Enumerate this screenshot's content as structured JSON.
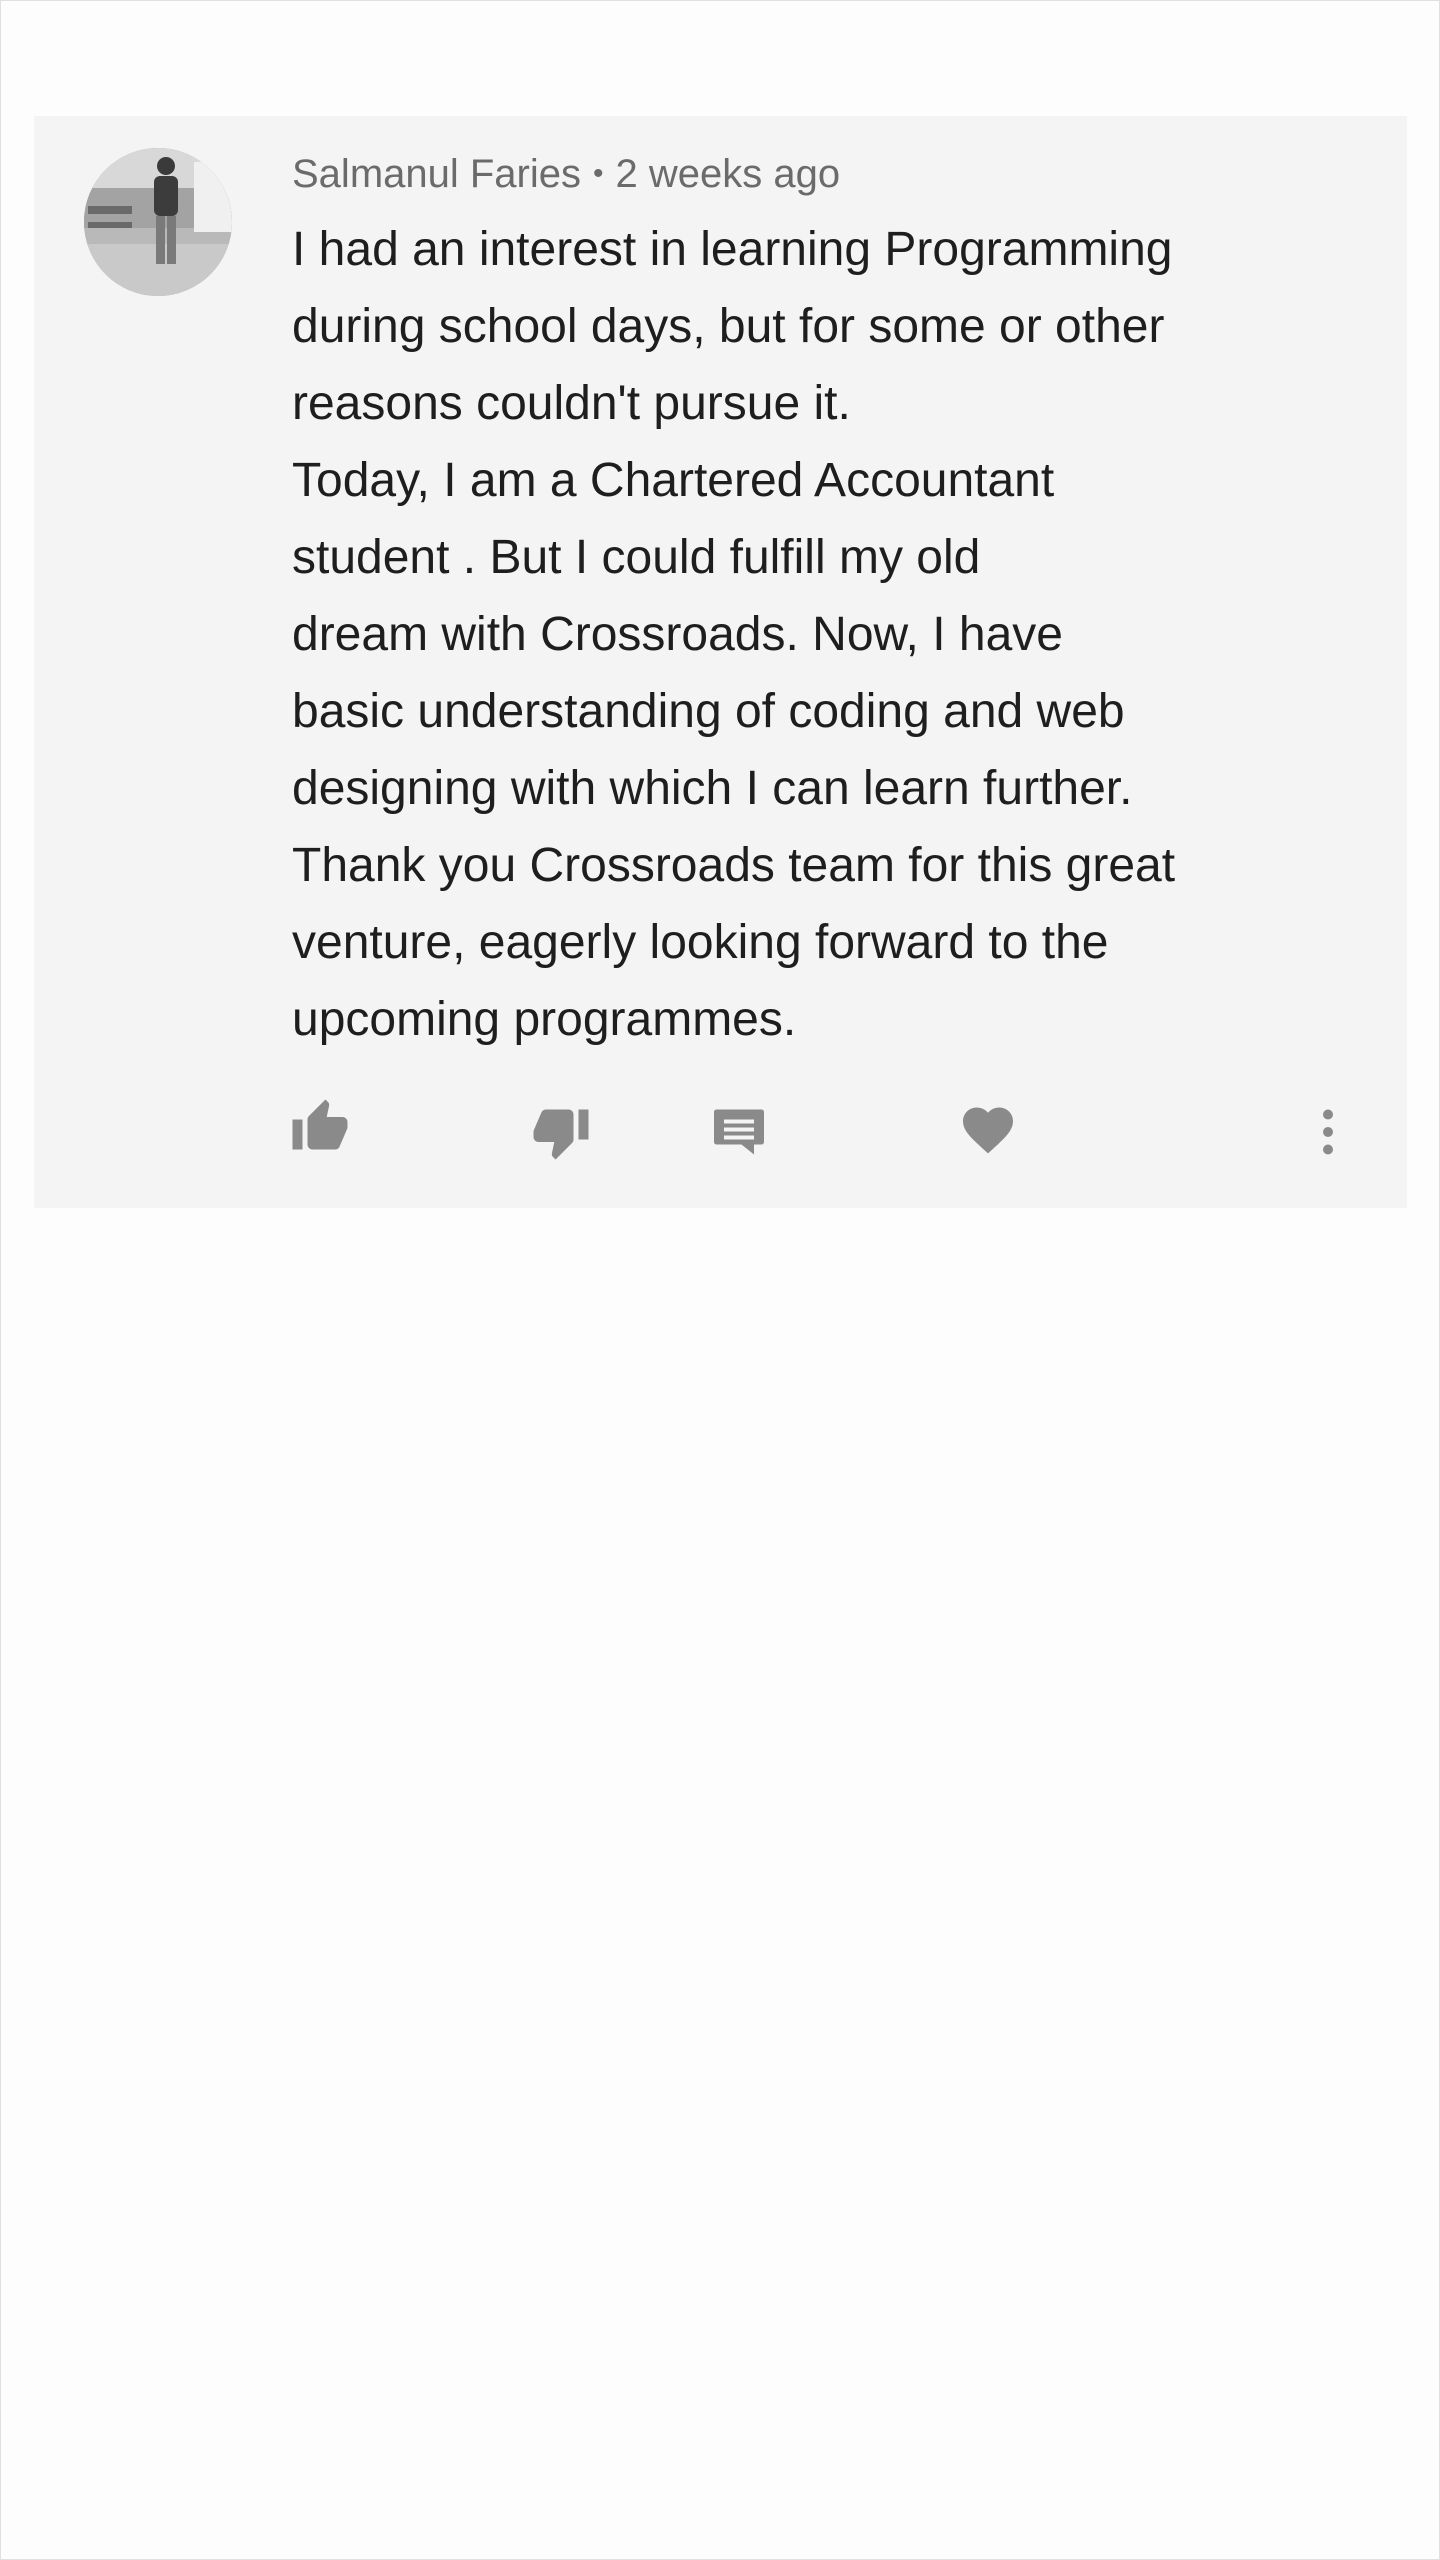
{
  "comment": {
    "author": "Salmanul Faries",
    "separator": "•",
    "timestamp": "2 weeks ago",
    "lines": [
      "I had an interest in learning Programming",
      "during school days, but for some or other",
      "reasons couldn't pursue it.",
      "Today, I am a Chartered Accountant",
      "student . But I could fulfill my old",
      "dream with Crossroads. Now, I have",
      "basic understanding of coding and web",
      "designing with which I can learn further.",
      "Thank you Crossroads team for this great",
      "venture, eagerly looking forward to the",
      "upcoming programmes."
    ]
  },
  "actions": [
    {
      "icon": "thumbs-up-icon"
    },
    {
      "icon": "thumbs-down-icon"
    },
    {
      "icon": "reply-icon"
    },
    {
      "icon": "heart-icon"
    },
    {
      "icon": "more-vertical-icon"
    }
  ],
  "colors": {
    "card_background": "#f4f4f4",
    "icon_gray": "#8a8a8a",
    "meta_text": "#6b6b6b",
    "body_text": "#1e1e1e"
  }
}
